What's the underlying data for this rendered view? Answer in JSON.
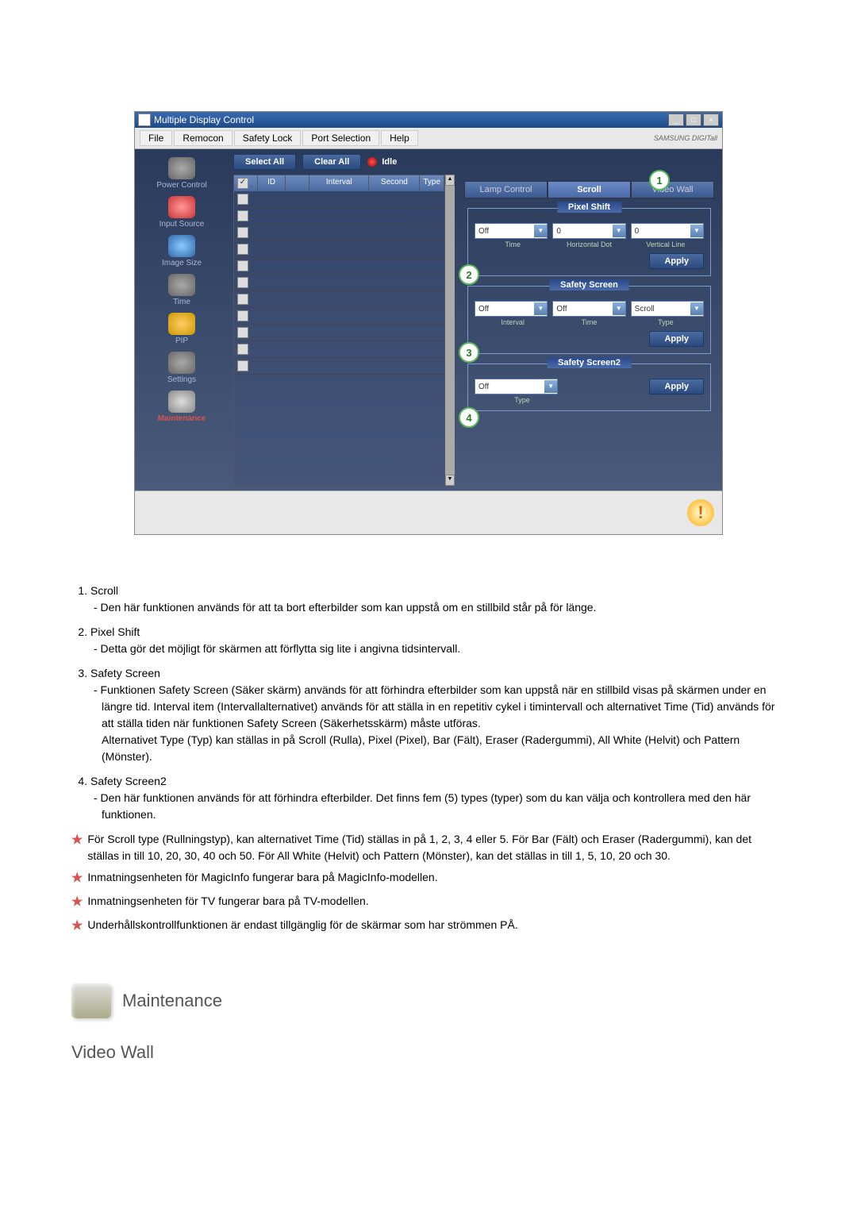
{
  "window": {
    "title": "Multiple Display Control"
  },
  "menu": {
    "file": "File",
    "remocon": "Remocon",
    "safety": "Safety Lock",
    "port": "Port Selection",
    "help": "Help",
    "brand": "SAMSUNG DIGITall"
  },
  "sidebar": {
    "power": "Power Control",
    "input": "Input Source",
    "image": "Image Size",
    "time": "Time",
    "pip": "PIP",
    "settings": "Settings",
    "maint": "Maintenance"
  },
  "toolbar": {
    "select": "Select All",
    "clear": "Clear All",
    "idle": "Idle"
  },
  "table": {
    "id": "ID",
    "interval": "Interval",
    "second": "Second",
    "type": "Type"
  },
  "tabs": {
    "lamp": "Lamp Control",
    "scroll": "Scroll",
    "video": "Video Wall"
  },
  "markers": {
    "m1": "1",
    "m2": "2",
    "m3": "3",
    "m4": "4"
  },
  "pixelShift": {
    "legend": "Pixel Shift",
    "off": "Off",
    "hd": "0",
    "vl": "0",
    "timeLabel": "Time",
    "hdLabel": "Horizontal Dot",
    "vlLabel": "Vertical Line",
    "apply": "Apply"
  },
  "safetyScreen": {
    "legend": "Safety Screen",
    "interval": "Off",
    "time": "Off",
    "type": "Scroll",
    "intLabel": "Interval",
    "timeLabel": "Time",
    "typeLabel": "Type",
    "apply": "Apply"
  },
  "safetyScreen2": {
    "legend": "Safety Screen2",
    "type": "Off",
    "typeLabel": "Type",
    "apply": "Apply"
  },
  "notes": {
    "n1": {
      "title": "Scroll",
      "body": "- Den här funktionen används för att ta bort efterbilder som kan uppstå om en stillbild står på för länge."
    },
    "n2": {
      "title": "Pixel Shift",
      "body": "- Detta gör det möjligt för skärmen att förflytta sig lite i angivna tidsintervall."
    },
    "n3": {
      "title": "Safety Screen",
      "body": "- Funktionen Safety Screen (Säker skärm) används för att förhindra efterbilder som kan uppstå när en stillbild visas på skärmen under en längre tid.  Interval item (Intervallalternativet) används för att ställa in en repetitiv cykel i timintervall och alternativet Time (Tid) används för att ställa tiden när funktionen Safety Screen (Säkerhetsskärm) måste utföras.",
      "body2": "Alternativet Type (Typ) kan ställas in på Scroll (Rulla), Pixel (Pixel), Bar (Fält), Eraser (Radergummi), All White (Helvit) och Pattern (Mönster)."
    },
    "n4": {
      "title": "Safety Screen2",
      "body": "- Den här funktionen används för att förhindra efterbilder. Det finns fem (5) types (typer) som du kan välja och kontrollera med den här funktionen."
    }
  },
  "stars": {
    "s1": "För Scroll type (Rullningstyp), kan alternativet Time (Tid) ställas in på 1, 2, 3, 4 eller 5. För Bar (Fält) och Eraser (Radergummi), kan det ställas in till 10, 20, 30, 40 och 50. För All White (Helvit) och Pattern (Mönster), kan det ställas in till 1, 5, 10, 20 och 30.",
    "s2": "Inmatningsenheten för MagicInfo fungerar bara på MagicInfo-modellen.",
    "s3": "Inmatningsenheten för TV fungerar bara på TV-modellen.",
    "s4": "Underhållskontrollfunktionen är endast tillgänglig för de skärmar som har strömmen PÅ."
  },
  "section": {
    "title": "Maintenance",
    "sub": "Video Wall"
  }
}
